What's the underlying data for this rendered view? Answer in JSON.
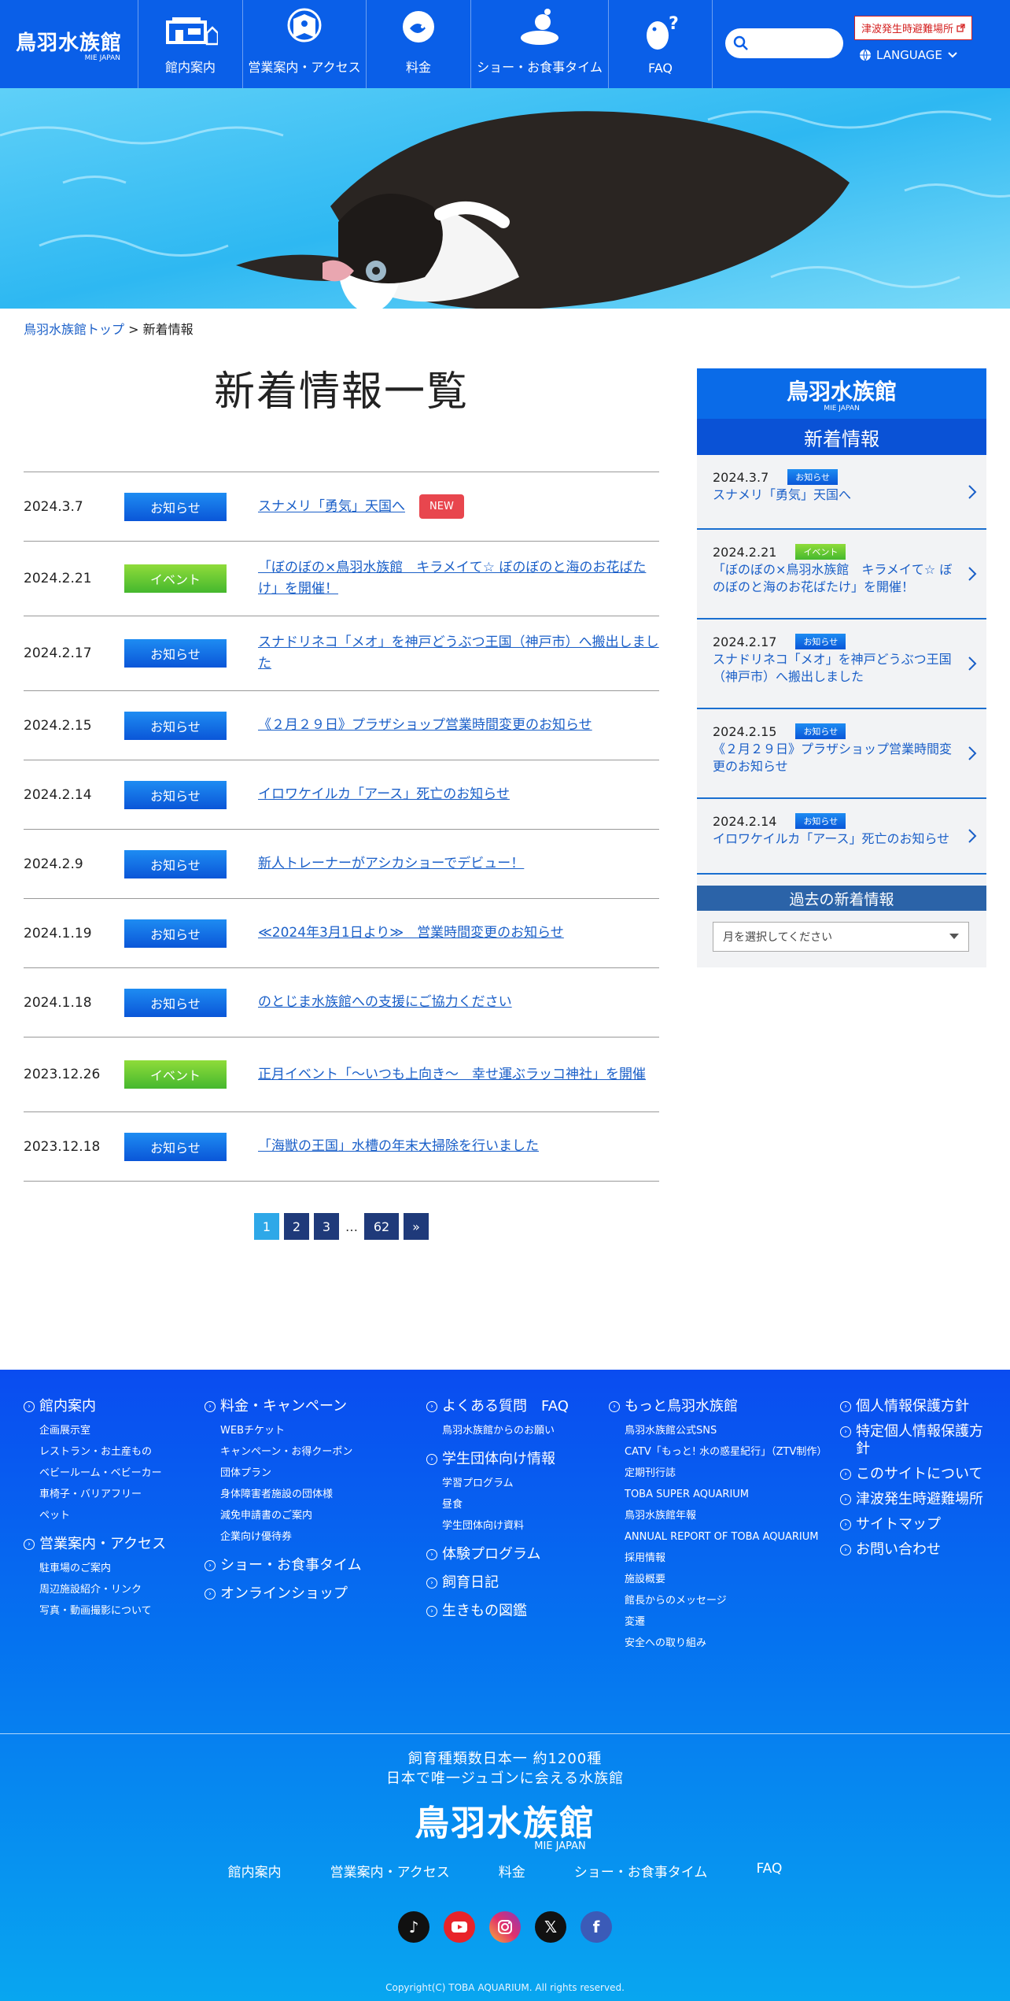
{
  "header": {
    "logo": "鳥羽水族館",
    "logo_sub": "MIE JAPAN",
    "nav": [
      {
        "label": "館内案内"
      },
      {
        "label": "営業案内・アクセス"
      },
      {
        "label": "料金"
      },
      {
        "label": "ショー・お食事タイム"
      },
      {
        "label": "FAQ"
      }
    ],
    "tsunami_link": "津波発生時避難場所",
    "language": "LANGUAGE"
  },
  "breadcrumb": {
    "home": "鳥羽水族館トップ",
    "separator": " > ",
    "current": "新着情報"
  },
  "page_title": "新着情報一覧",
  "news": [
    {
      "date": "2024.3.7",
      "category": "お知らせ",
      "title": "スナメリ「勇気」天国へ",
      "new_tag": "NEW"
    },
    {
      "date": "2024.2.21",
      "category": "イベント",
      "title": "「ぼのぼの×鳥羽水族館　キラメイて☆ ぼのぼのと海のお花ばたけ」を開催！"
    },
    {
      "date": "2024.2.17",
      "category": "お知らせ",
      "title": "スナドリネコ「メオ」を神戸どうぶつ王国（神戸市）へ搬出しました"
    },
    {
      "date": "2024.2.15",
      "category": "お知らせ",
      "title": "《２月２９日》プラザショップ営業時間変更のお知らせ"
    },
    {
      "date": "2024.2.14",
      "category": "お知らせ",
      "title": "イロワケイルカ「アース」死亡のお知らせ"
    },
    {
      "date": "2024.2.9",
      "category": "お知らせ",
      "title": "新人トレーナーがアシカショーでデビュー！"
    },
    {
      "date": "2024.1.19",
      "category": "お知らせ",
      "title": "≪2024年3月1日より≫　営業時間変更のお知らせ"
    },
    {
      "date": "2024.1.18",
      "category": "お知らせ",
      "title": "のとじま水族館への支援にご協力ください"
    },
    {
      "date": "2023.12.26",
      "category": "イベント",
      "title": "正月イベント「～いつも上向き～　幸せ運ぶラッコ神社」を開催"
    },
    {
      "date": "2023.12.18",
      "category": "お知らせ",
      "title": "「海獣の王国」水槽の年末大掃除を行いました"
    }
  ],
  "pagination": {
    "pages": [
      "1",
      "2",
      "3"
    ],
    "ellipsis": "…",
    "last": "62",
    "next": "»",
    "current": "1"
  },
  "sidebar": {
    "logo": "鳥羽水族館",
    "logo_sub": "MIE JAPAN",
    "heading": "新着情報",
    "items": [
      {
        "date": "2024.3.7",
        "category": "お知らせ",
        "title": "スナメリ「勇気」天国へ"
      },
      {
        "date": "2024.2.21",
        "category": "イベント",
        "title": "「ぼのぼの×鳥羽水族館　キラメイて☆ ぼのぼのと海のお花ばたけ」を開催！"
      },
      {
        "date": "2024.2.17",
        "category": "お知らせ",
        "title": "スナドリネコ「メオ」を神戸どうぶつ王国（神戸市）へ搬出しました"
      },
      {
        "date": "2024.2.15",
        "category": "お知らせ",
        "title": "《２月２９日》プラザショップ営業時間変更のお知らせ"
      },
      {
        "date": "2024.2.14",
        "category": "お知らせ",
        "title": "イロワケイルカ「アース」死亡のお知らせ"
      }
    ],
    "past_heading": "過去の新着情報",
    "select_placeholder": "月を選択してください"
  },
  "footer": {
    "col1": {
      "head1": "館内案内",
      "items1": [
        "企画展示室",
        "レストラン・お土産もの",
        "ベビールーム・ベビーカー",
        "車椅子・バリアフリー",
        "ペット"
      ],
      "head2": "営業案内・アクセス",
      "items2": [
        "駐車場のご案内",
        "周辺施設紹介・リンク",
        "写真・動画撮影について"
      ]
    },
    "col2": {
      "head1": "料金・キャンペーン",
      "items1": [
        "WEBチケット",
        "キャンペーン・お得クーポン",
        "団体プラン",
        "身体障害者施設の団体様",
        "減免申請書のご案内",
        "企業向け優待券"
      ],
      "head2": "ショー・お食事タイム",
      "head3": "オンラインショップ"
    },
    "col3": {
      "head1": "よくある質問　FAQ",
      "items1": [
        "鳥羽水族館からのお願い"
      ],
      "head2": "学生団体向け情報",
      "items2": [
        "学習プログラム",
        "昼食",
        "学生団体向け資料"
      ],
      "head3": "体験プログラム",
      "head4": "飼育日記",
      "head5": "生きもの図鑑"
    },
    "col4": {
      "head1": "もっと鳥羽水族館",
      "items1": [
        "鳥羽水族館公式SNS",
        "CATV「もっと! 水の惑星紀行」（ZTV制作）",
        "定期刊行誌",
        "TOBA SUPER AQUARIUM",
        "鳥羽水族館年報",
        "ANNUAL REPORT OF TOBA AQUARIUM",
        "採用情報",
        "施設概要",
        "館長からのメッセージ",
        "変遷",
        "安全への取り組み"
      ]
    },
    "col5": {
      "items": [
        "個人情報保護方針",
        "特定個人情報保護方針",
        "このサイトについて",
        "津波発生時避難場所",
        "サイトマップ",
        "お問い合わせ"
      ]
    },
    "tagline1": "飼育種類数日本一 約1200種",
    "tagline2": "日本で唯一ジュゴンに会える水族館",
    "logo": "鳥羽水族館",
    "logo_sub": "MIE JAPAN",
    "nav": [
      "館内案内",
      "営業案内・アクセス",
      "料金",
      "ショー・お食事タイム",
      "FAQ"
    ],
    "copyright": "Copyright(C) TOBA AQUARIUM. All rights reserved."
  },
  "colors": {
    "header_blue": "#0a5fe8",
    "info_badge": "#0a56d8",
    "event_badge": "#45b82e",
    "new_tag": "#e8464e",
    "link": "#1a5fc8"
  }
}
